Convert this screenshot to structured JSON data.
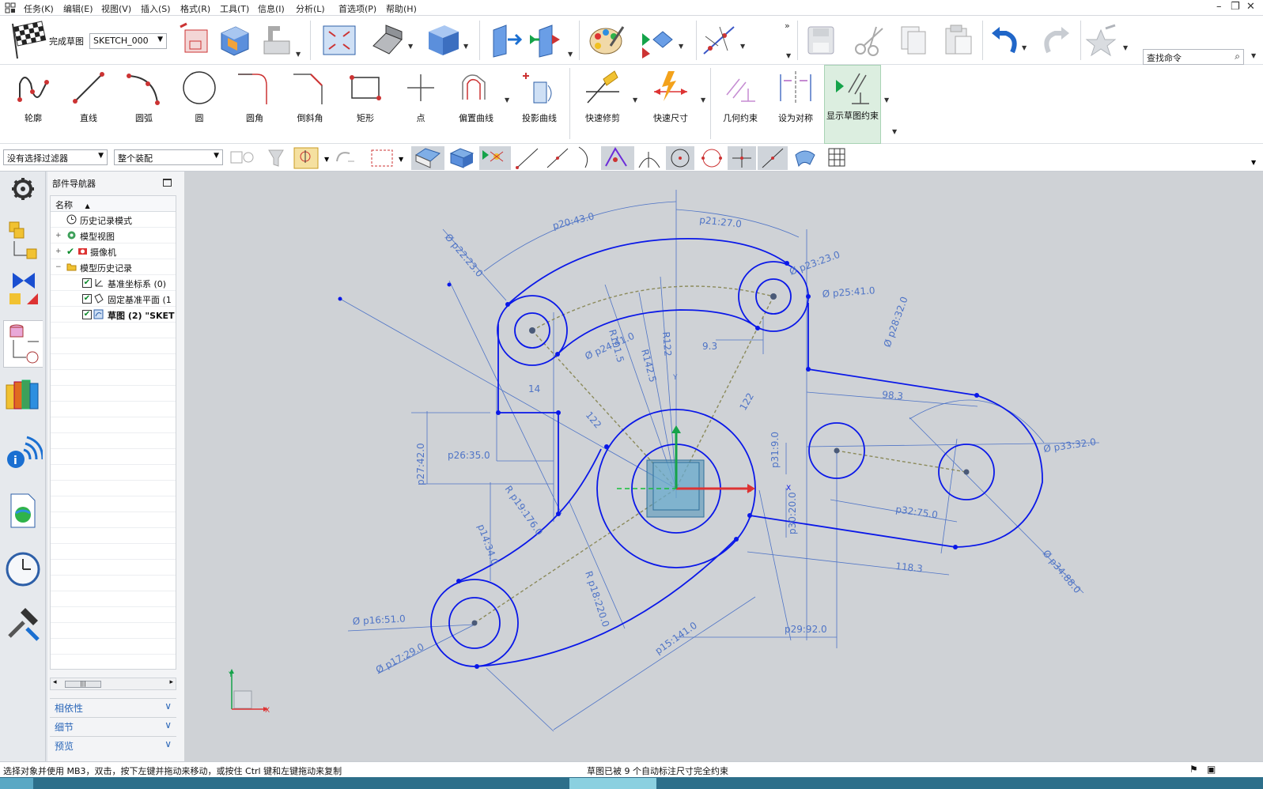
{
  "menu": [
    "任务(K)",
    "编辑(E)",
    "视图(V)",
    "插入(S)",
    "格式(R)",
    "工具(T)",
    "信息(I)",
    "分析(L)",
    "首选项(P)",
    "帮助(H)"
  ],
  "toolbar1": {
    "finish_sketch_label": "完成草图",
    "sketch_name": "SKETCH_000",
    "search_placeholder": "查找命令"
  },
  "sketch_tools": [
    {
      "label": "轮廓"
    },
    {
      "label": "直线"
    },
    {
      "label": "圆弧"
    },
    {
      "label": "圆"
    },
    {
      "label": "圆角"
    },
    {
      "label": "倒斜角"
    },
    {
      "label": "矩形"
    },
    {
      "label": "点"
    },
    {
      "label": "偏置曲线"
    },
    {
      "label": "投影曲线"
    },
    {
      "label": "快速修剪"
    },
    {
      "label": "快速尺寸"
    },
    {
      "label": "几何约束"
    },
    {
      "label": "设为对称"
    },
    {
      "label": "显示草图约束"
    }
  ],
  "filters": {
    "selection_filter": "没有选择过滤器",
    "scope": "整个装配"
  },
  "navigator": {
    "title": "部件导航器",
    "column": "名称",
    "items": [
      {
        "label": "历史记录模式"
      },
      {
        "label": "模型视图"
      },
      {
        "label": "摄像机"
      },
      {
        "label": "模型历史记录"
      },
      {
        "label": "基准坐标系 (0)"
      },
      {
        "label": "固定基准平面 (1"
      },
      {
        "label": "草图 (2) \"SKET"
      }
    ],
    "sections": [
      "相依性",
      "细节",
      "预览"
    ]
  },
  "canvas": {
    "dimensions": [
      "p20:43.0",
      "p21:27.0",
      "Ø p22:23.0",
      "Ø p23:23.0",
      "Ø p25:41.0",
      "Ø p28:32.0",
      "R101.5",
      "R142.5",
      "R122",
      "9.3",
      "Ø p24:41.0",
      "14",
      "122",
      "122",
      "98.3",
      "p26:35.0",
      "p27:42.0",
      "R p19:176.0",
      "p14:34.0",
      "R p18:220.0",
      "p31:9.0",
      "p30:20.0",
      "p32:75.0",
      "118.3",
      "Ø p33:32.0",
      "Ø p34:88.0",
      "Ø p16:51.0",
      "Ø p17:29.0",
      "p15:141.0",
      "p29:92.0"
    ],
    "axis_labels": {
      "x": "X",
      "y": "Y"
    }
  },
  "status": {
    "prompt": "选择对象并使用 MB3，双击，按下左键并拖动来移动，或按住 Ctrl 键和左键拖动来复制",
    "message": "草图已被 9 个自动标注尺寸完全约束"
  },
  "colors": {
    "geometry": "#0a18e8",
    "dimension": "#4f74c6",
    "construction": "#8b8a5a",
    "background": "#cfd2d6"
  }
}
